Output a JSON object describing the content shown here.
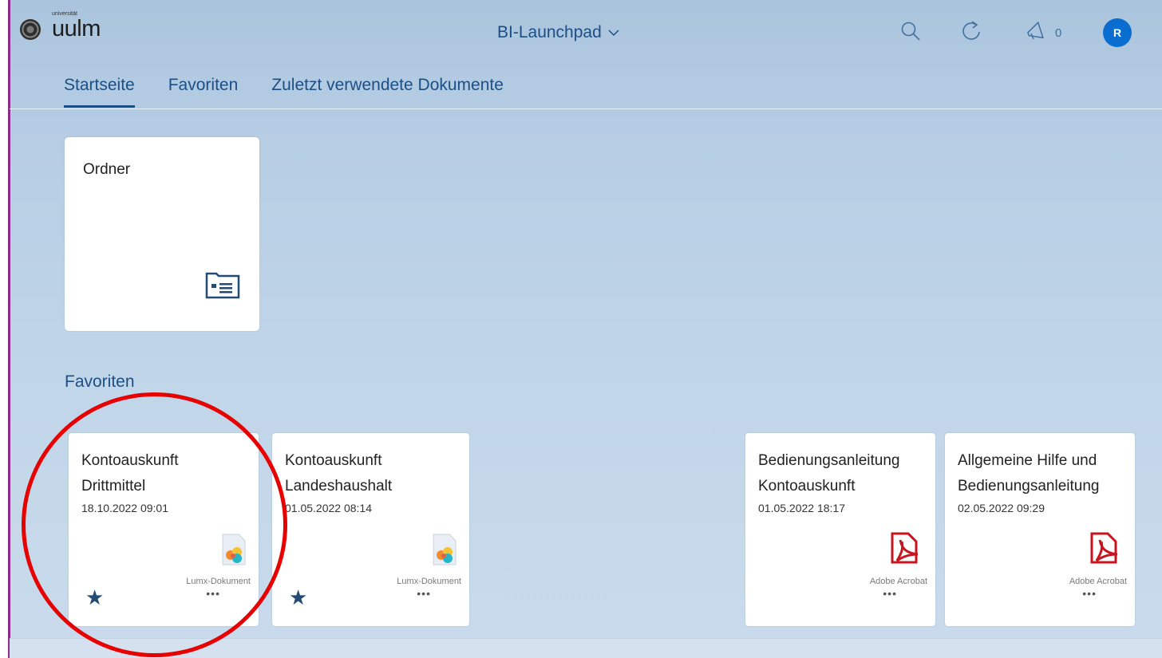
{
  "header": {
    "logo_small": "universität",
    "logo_text": "uulm",
    "app_title": "BI-Launchpad",
    "notification_count": "0",
    "avatar_initial": "R"
  },
  "tabs": [
    {
      "label": "Startseite",
      "active": true
    },
    {
      "label": "Favoriten",
      "active": false
    },
    {
      "label": "Zuletzt verwendete Dokumente",
      "active": false
    }
  ],
  "folder_tile": {
    "title": "Ordner",
    "icon": "folder-list-icon"
  },
  "favorites": {
    "heading": "Favoriten",
    "items": [
      {
        "title_line1": "Kontoauskunft",
        "title_line2": "Drittmittel",
        "date": "18.10.2022 09:01",
        "type": "Lumx-Dokument",
        "icon": "lumx-document-icon",
        "starred": true
      },
      {
        "title_line1": "Kontoauskunft",
        "title_line2": "Landeshaushalt",
        "date": "01.05.2022 08:14",
        "type": "Lumx-Dokument",
        "icon": "lumx-document-icon",
        "starred": true
      },
      {
        "title_line1": "Bedienungsanleitung",
        "title_line2": "Kontoauskunft",
        "date": "01.05.2022 18:17",
        "type": "Adobe Acrobat",
        "icon": "pdf-icon",
        "starred": false
      },
      {
        "title_line1": "Allgemeine Hilfe und",
        "title_line2": "Bedienungsanleitung",
        "date": "02.05.2022 09:29",
        "type": "Adobe Acrobat",
        "icon": "pdf-icon",
        "starred": false
      }
    ],
    "more_label": "•••",
    "star_glyph": "★"
  },
  "colors": {
    "accent": "#1b4f85",
    "avatar": "#0a6ed1",
    "highlight_circle": "#e60000",
    "pdf_red": "#c8141e"
  }
}
